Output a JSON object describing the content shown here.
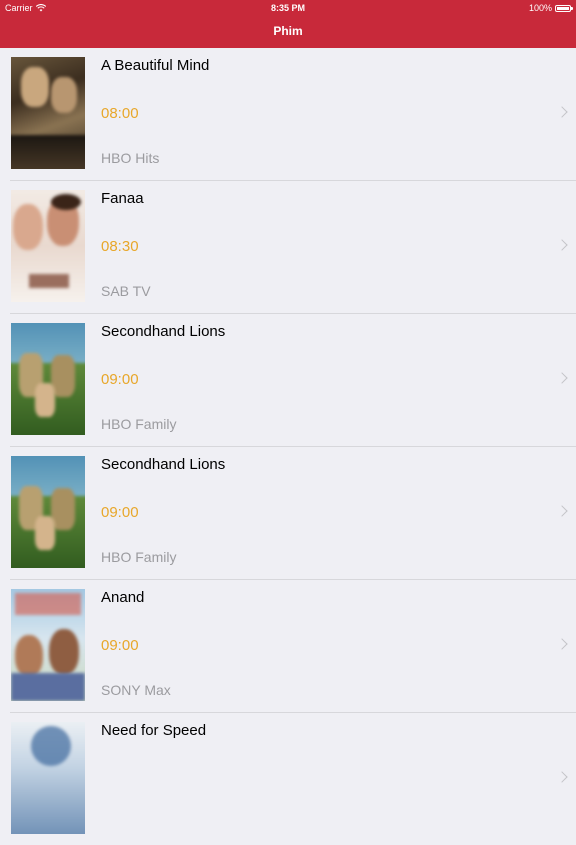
{
  "status_bar": {
    "carrier": "Carrier",
    "time": "8:35 PM",
    "battery": "100%"
  },
  "nav": {
    "title": "Phim"
  },
  "movies": [
    {
      "title": "A Beautiful Mind",
      "time": "08:00",
      "channel": "HBO Hits"
    },
    {
      "title": "Fanaa",
      "time": "08:30",
      "channel": "SAB TV"
    },
    {
      "title": "Secondhand Lions",
      "time": "09:00",
      "channel": "HBO Family"
    },
    {
      "title": "Secondhand Lions",
      "time": "09:00",
      "channel": "HBO Family"
    },
    {
      "title": "Anand",
      "time": "09:00",
      "channel": "SONY Max"
    },
    {
      "title": "Need for Speed",
      "time": "",
      "channel": ""
    }
  ],
  "colors": {
    "nav_background": "#c8293a",
    "time_accent": "#e8a72a",
    "channel_text": "#9b9b9f"
  }
}
